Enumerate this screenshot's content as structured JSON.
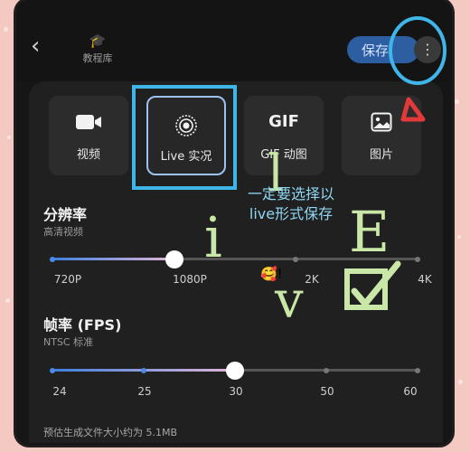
{
  "header": {
    "back_icon": "chevron-left-icon",
    "library_icon": "graduation-cap-icon",
    "library_label": "教程库",
    "save_label": "保存",
    "more_icon": "more-vertical-icon"
  },
  "modes": [
    {
      "icon": "video-camera-icon",
      "label": "视频",
      "selected": false
    },
    {
      "icon": "live-photo-icon",
      "label": "Live 实况",
      "selected": true
    },
    {
      "icon": "gif-icon",
      "icon_text": "GIF",
      "label": "GIF 动图",
      "selected": false
    },
    {
      "icon": "image-icon",
      "label": "图片",
      "selected": false
    }
  ],
  "resolution": {
    "title": "分辨率",
    "subtitle": "高清视频",
    "options": [
      "720P",
      "1080P",
      "2K",
      "4K"
    ],
    "selected": "1080P"
  },
  "framerate": {
    "title": "帧率 (FPS)",
    "subtitle": "NTSC 标准",
    "options": [
      "24",
      "25",
      "30",
      "50",
      "60"
    ],
    "selected": "30"
  },
  "estimate": "预估生成文件大小约为 5.1MB",
  "annotations": {
    "note": "一定要选择以live形式保存",
    "emoji": "🥰!",
    "handwriting": [
      "l",
      "i",
      "v",
      "E"
    ],
    "colors": {
      "highlight": "#3fb5e8",
      "handwriting": "#c9e8a8",
      "note": "#8fd6f2",
      "accent_red": "#e03a3a"
    }
  }
}
